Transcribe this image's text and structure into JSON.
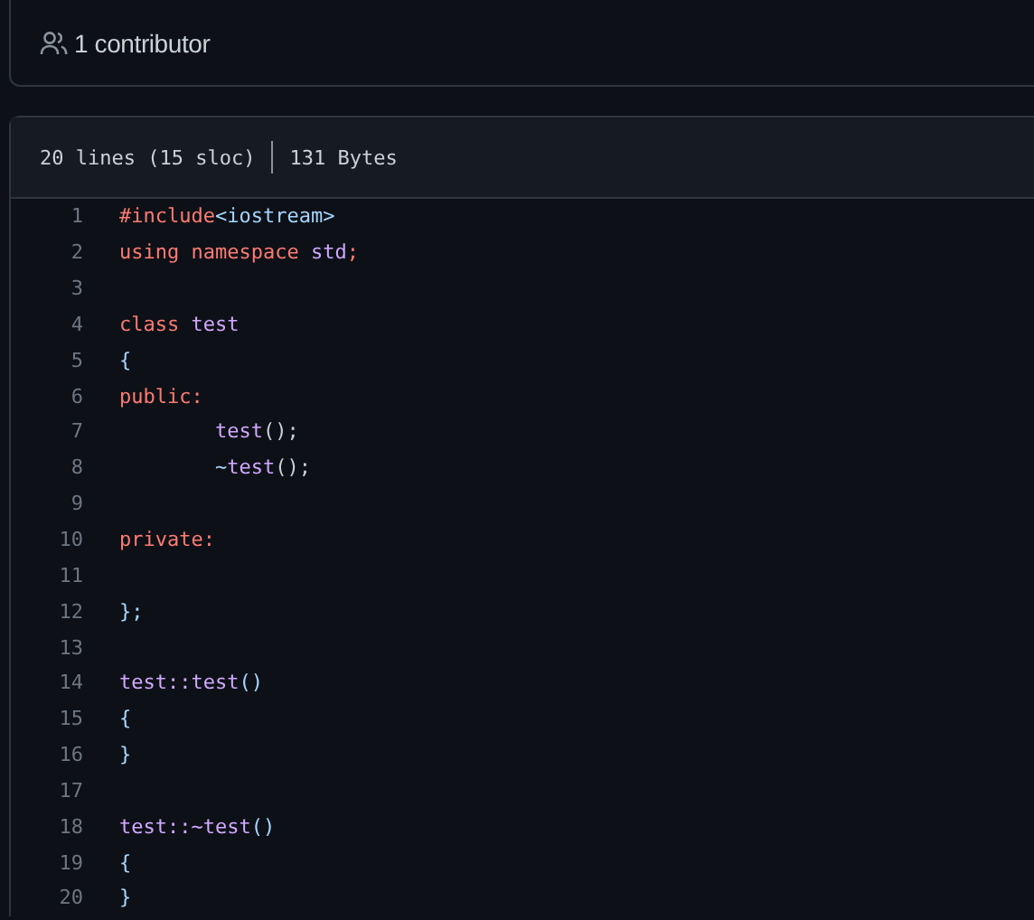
{
  "contributors": {
    "label": "1 contributor"
  },
  "file_info": {
    "lines": "20 lines (15 sloc)",
    "size": "131 Bytes"
  },
  "code_lines": [
    {
      "number": "1",
      "tokens": [
        {
          "text": "#include",
          "kind": "keyword"
        },
        {
          "text": "<iostream>",
          "kind": "string"
        }
      ]
    },
    {
      "number": "2",
      "tokens": [
        {
          "text": "using namespace ",
          "kind": "keyword"
        },
        {
          "text": "std",
          "kind": "entity"
        },
        {
          "text": ";",
          "kind": "keyword"
        }
      ]
    },
    {
      "number": "3"
    },
    {
      "number": "4",
      "tokens": [
        {
          "text": "class ",
          "kind": "keyword"
        },
        {
          "text": "test",
          "kind": "entity"
        }
      ]
    },
    {
      "number": "5",
      "tokens": [
        {
          "text": "{",
          "kind": "string"
        }
      ]
    },
    {
      "number": "6",
      "tokens": [
        {
          "text": "public:",
          "kind": "keyword"
        }
      ]
    },
    {
      "number": "7",
      "tokens": [
        {
          "text": "\ttest",
          "kind": "entity"
        },
        {
          "text": "();",
          "kind": "plain"
        }
      ]
    },
    {
      "number": "8",
      "tokens": [
        {
          "text": "\t~",
          "kind": "string"
        },
        {
          "text": "test",
          "kind": "entity"
        },
        {
          "text": "();",
          "kind": "plain"
        }
      ]
    },
    {
      "number": "9"
    },
    {
      "number": "10",
      "tokens": [
        {
          "text": "private:",
          "kind": "keyword"
        }
      ]
    },
    {
      "number": "11"
    },
    {
      "number": "12",
      "tokens": [
        {
          "text": "};",
          "kind": "string"
        }
      ]
    },
    {
      "number": "13"
    },
    {
      "number": "14",
      "tokens": [
        {
          "text": "test::test",
          "kind": "entity"
        },
        {
          "text": "()",
          "kind": "string"
        }
      ]
    },
    {
      "number": "15",
      "tokens": [
        {
          "text": "{",
          "kind": "string"
        }
      ]
    },
    {
      "number": "16",
      "tokens": [
        {
          "text": "}",
          "kind": "string"
        }
      ]
    },
    {
      "number": "17"
    },
    {
      "number": "18",
      "tokens": [
        {
          "text": "test::~test",
          "kind": "entity"
        },
        {
          "text": "()",
          "kind": "string"
        }
      ]
    },
    {
      "number": "19",
      "tokens": [
        {
          "text": "{",
          "kind": "string"
        }
      ]
    },
    {
      "number": "20",
      "tokens": [
        {
          "text": "}",
          "kind": "string"
        }
      ]
    }
  ]
}
